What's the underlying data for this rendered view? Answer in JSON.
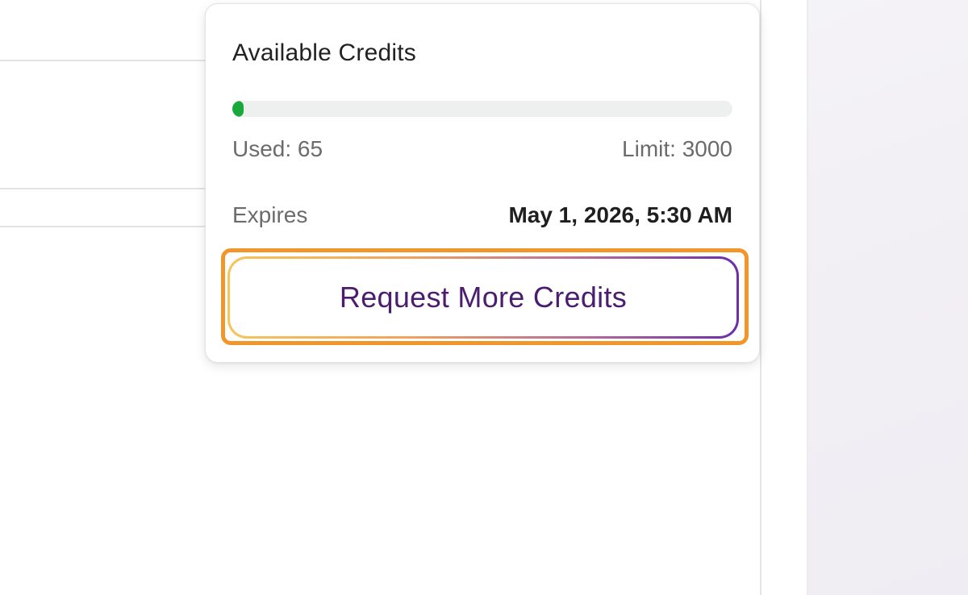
{
  "popover": {
    "title": "Available Credits",
    "usage": {
      "used_label": "Used: 65",
      "limit_label": "Limit: 3000",
      "used": 65,
      "limit": 3000
    },
    "expires": {
      "label": "Expires",
      "value": "May 1, 2026, 5:30 AM"
    },
    "request_button_label": "Request More Credits"
  },
  "colors": {
    "progress_fill": "#1aa83a",
    "progress_track": "#eef0ef",
    "button_text": "#4a1d6f",
    "highlight": "#f0962b"
  }
}
